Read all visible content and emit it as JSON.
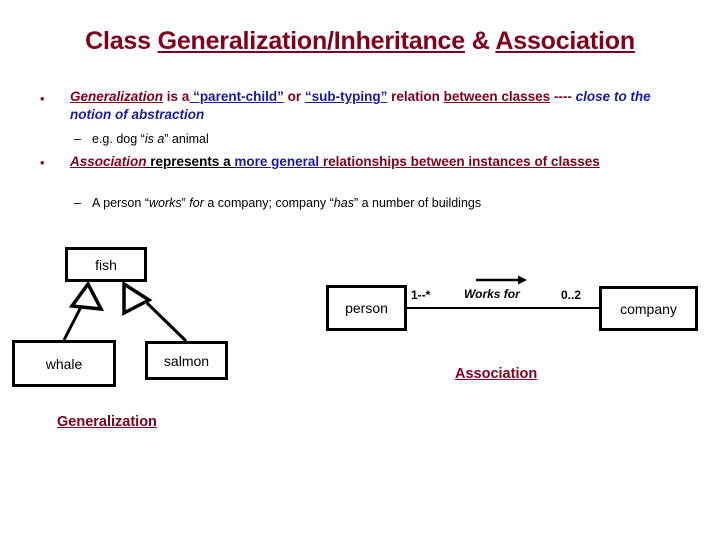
{
  "slide": {
    "title": {
      "prefix": "Class ",
      "part_underlined_1": "Generalization/Inheritance",
      "joiner": " & ",
      "part_underlined_2": "Association"
    },
    "bullets": [
      {
        "marker": "•",
        "segments": [
          {
            "text": "Generalization",
            "color": "maroon",
            "italic": true,
            "underline": true
          },
          {
            "text": " is a",
            "color": "maroon",
            "italic": false,
            "underline": false
          },
          {
            "text": " “parent-child”",
            "color": "blue",
            "italic": false,
            "underline": true
          },
          {
            "text": " or ",
            "color": "maroon",
            "italic": false,
            "underline": false
          },
          {
            "text": "“sub-typing”",
            "color": "blue",
            "italic": false,
            "underline": true
          },
          {
            "text": " relation ",
            "color": "maroon",
            "italic": false,
            "underline": false
          },
          {
            "text": "between classes",
            "color": "maroon",
            "italic": false,
            "underline": true
          },
          {
            "text": " ---- ",
            "color": "maroon",
            "italic": false,
            "underline": false
          },
          {
            "text": "close to the notion of abstraction",
            "color": "blue",
            "italic": true,
            "underline": false
          }
        ],
        "sub": {
          "marker": "–",
          "segments": [
            {
              "text": "e.g.  dog “",
              "italic": false
            },
            {
              "text": "is a",
              "italic": true
            },
            {
              "text": "” animal",
              "italic": false
            }
          ]
        }
      },
      {
        "marker": "•",
        "segments": [
          {
            "text": "Association",
            "color": "maroon",
            "italic": true,
            "underline": true
          },
          {
            "text": " represents a ",
            "color": "black",
            "italic": false,
            "underline": true
          },
          {
            "text": "more general",
            "color": "blue",
            "italic": false,
            "underline": true
          },
          {
            "text": " relationships between instances of classes",
            "color": "maroon",
            "italic": false,
            "underline": true
          }
        ],
        "sub": {
          "marker": "–",
          "segments": [
            {
              "text": "A person “",
              "italic": false
            },
            {
              "text": "works",
              "italic": true
            },
            {
              "text": "” ",
              "italic": false
            },
            {
              "text": "for",
              "italic": true
            },
            {
              "text": " a company;  company “",
              "italic": false
            },
            {
              "text": "has",
              "italic": true
            },
            {
              "text": "” a number of buildings",
              "italic": false
            }
          ]
        }
      }
    ],
    "diagram_generalization": {
      "caption": "Generalization",
      "nodes": {
        "parent": "fish",
        "child_left": "whale",
        "child_right": "salmon"
      }
    },
    "diagram_association": {
      "caption": "Association",
      "nodes": {
        "left": "person",
        "right": "company"
      },
      "multiplicity_left": "1--*",
      "multiplicity_right": "0..2",
      "verb": "Works for"
    },
    "colors": {
      "maroon": "#800020",
      "blue": "#1a1a9c",
      "black": "#000000",
      "background": "#ffffff"
    }
  }
}
